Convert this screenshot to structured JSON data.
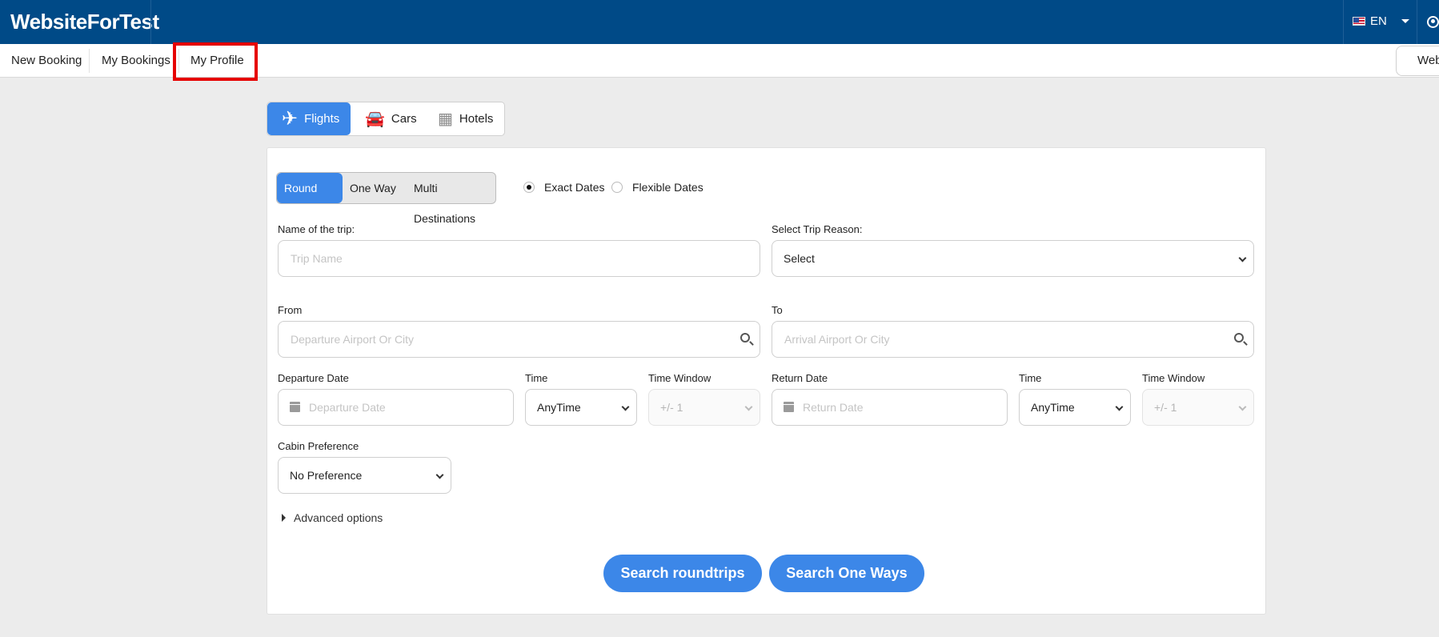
{
  "header": {
    "brand": "WebsiteForTest",
    "language": "EN"
  },
  "nav": {
    "items": [
      "New Booking",
      "My Bookings",
      "My Profile"
    ],
    "right_pill": "Web"
  },
  "product_tabs": [
    "Flights",
    "Cars",
    "Hotels"
  ],
  "trip_types": [
    "Round Trip",
    "One Way",
    "Multi Destinations"
  ],
  "date_modes": [
    "Exact Dates",
    "Flexible Dates"
  ],
  "form": {
    "trip_name": {
      "label": "Name of the trip:",
      "placeholder": "Trip Name"
    },
    "trip_reason": {
      "label": "Select Trip Reason:",
      "value": "Select"
    },
    "from": {
      "label": "From",
      "placeholder": "Departure Airport Or City"
    },
    "to": {
      "label": "To",
      "placeholder": "Arrival Airport Or City"
    },
    "departure_date": {
      "label": "Departure Date",
      "placeholder": "Departure Date"
    },
    "departure_time": {
      "label": "Time",
      "value": "AnyTime"
    },
    "departure_window": {
      "label": "Time Window",
      "value": "+/- 1"
    },
    "return_date": {
      "label": "Return Date",
      "placeholder": "Return Date"
    },
    "return_time": {
      "label": "Time",
      "value": "AnyTime"
    },
    "return_window": {
      "label": "Time Window",
      "value": "+/- 1"
    },
    "cabin": {
      "label": "Cabin Preference",
      "value": "No Preference"
    },
    "advanced": "Advanced options"
  },
  "buttons": {
    "search_roundtrips": "Search roundtrips",
    "search_one_ways": "Search One Ways"
  },
  "colors": {
    "header_bg": "#004a87",
    "accent": "#3c87e8",
    "highlight": "#e60000"
  }
}
